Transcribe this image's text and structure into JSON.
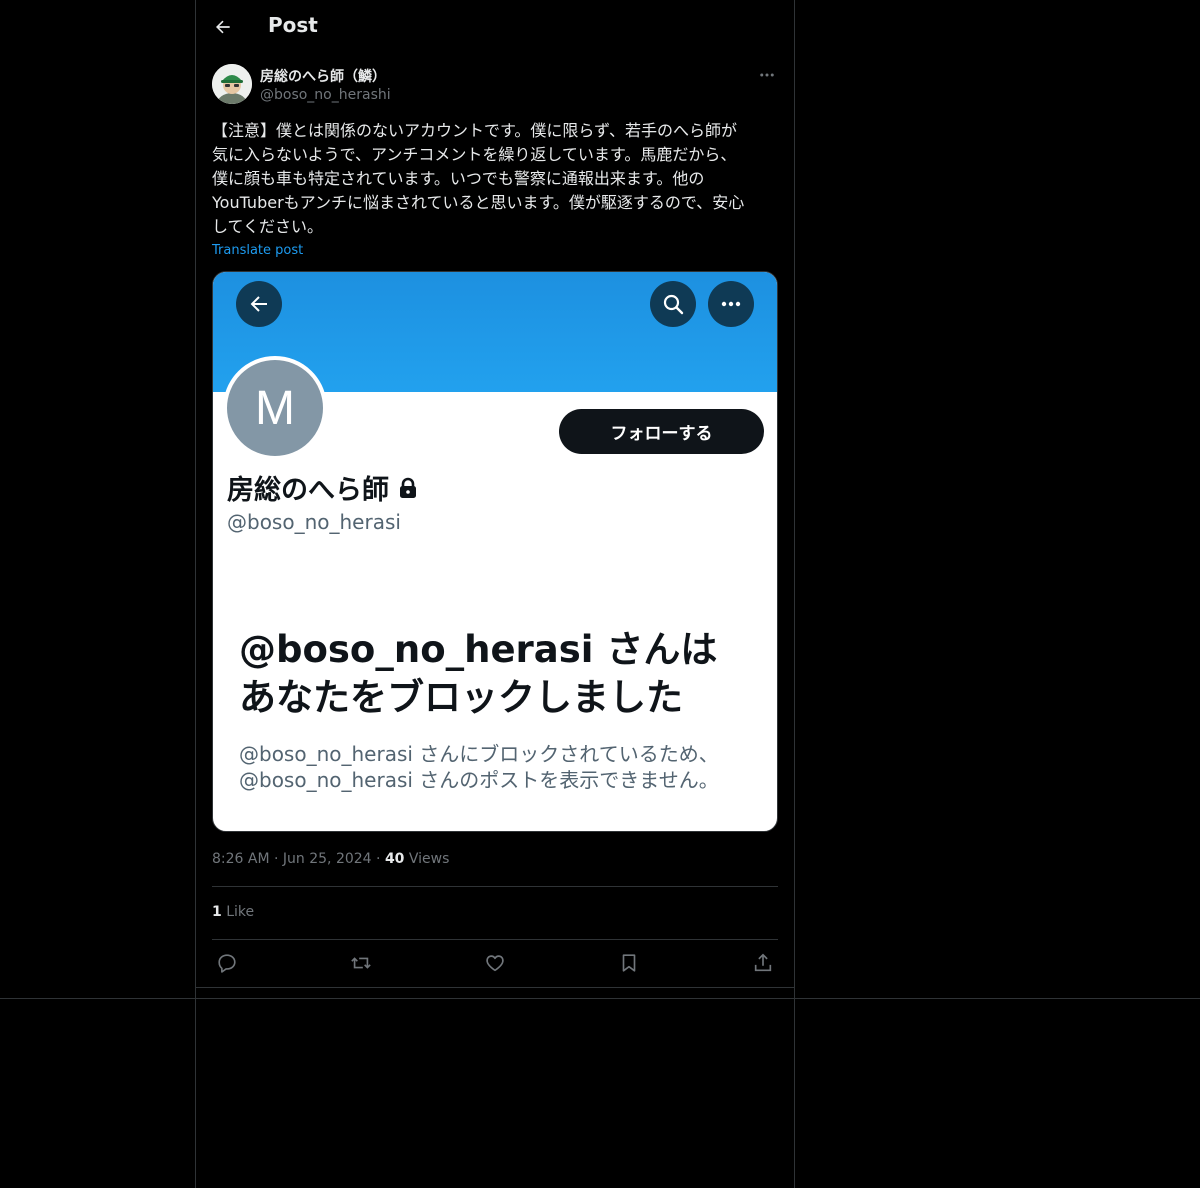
{
  "header": {
    "title": "Post"
  },
  "author": {
    "name": "房総のへら師（鱗）",
    "handle": "@boso_no_herashi"
  },
  "post": {
    "text": "【注意】僕とは関係のないアカウントです。僕に限らず、若手のへら師が\n気に入らないようで、アンチコメントを繰り返しています。馬鹿だから、\n僕に顔も車も特定されています。いつでも警察に通報出来ます。他の\nYouTuberもアンチに悩まされていると思います。僕が駆逐するので、安心\nしてください。",
    "translate_label": "Translate post",
    "time": "8:26 AM",
    "date": "Jun 25, 2024",
    "views_count": "40",
    "views_label": "Views",
    "likes_count": "1",
    "likes_label": "Like"
  },
  "media": {
    "avatar_letter": "M",
    "follow_label": "フォローする",
    "profile_name": "房総のへら師",
    "profile_handle": "@boso_no_herasi",
    "blocked_title_line1": "@boso_no_herasi さんは",
    "blocked_title_line2": "あなたをブロックしました",
    "blocked_desc_line1": "@boso_no_herasi さんにブロックされているため、",
    "blocked_desc_line2": "@boso_no_herasi さんのポストを表示できません。",
    "banner_color": "#1d9bf0"
  },
  "icons": [
    "back-arrow-icon",
    "more-icon",
    "lock-icon",
    "search-icon",
    "reply-icon",
    "repost-icon",
    "like-icon",
    "bookmark-icon",
    "share-icon"
  ]
}
